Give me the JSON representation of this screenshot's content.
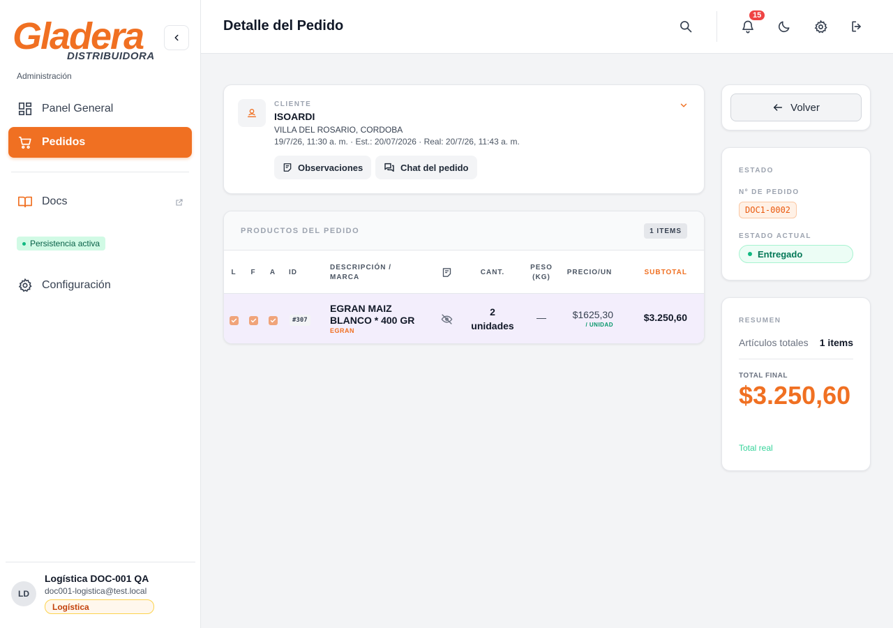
{
  "brand": {
    "logo_main": "Gladera",
    "logo_sub": "DISTRIBUIDORA",
    "accent": "#f07022"
  },
  "sidebar": {
    "section_label": "Administración",
    "items": [
      {
        "label": "Panel General",
        "icon": "dashboard-icon"
      },
      {
        "label": "Pedidos",
        "icon": "cart-icon",
        "active": true
      },
      {
        "label": "Docs",
        "icon": "book-icon",
        "external": true
      },
      {
        "label": "Configuración",
        "icon": "gear-icon"
      }
    ],
    "persistence_badge": "Persistencia activa"
  },
  "user": {
    "initials": "LD",
    "name": "Logística DOC-001 QA",
    "email": "doc001-logistica@test.local",
    "role": "Logística"
  },
  "header": {
    "title": "Detalle del Pedido",
    "notifications_count": "15"
  },
  "client": {
    "label": "CLIENTE",
    "name": "ISOARDI",
    "location": "VILLA DEL ROSARIO, CORDOBA",
    "dates": "19/7/26, 11:30 a. m. · Est.: 20/07/2026 · Real: 20/7/26, 11:43 a. m.",
    "observations_label": "Observaciones",
    "chat_label": "Chat del pedido"
  },
  "products": {
    "title": "PRODUCTOS DEL PEDIDO",
    "items_badge": "1 ITEMS",
    "columns": {
      "l": "L",
      "f": "F",
      "a": "A",
      "id": "ID",
      "desc_line1": "DESCRIPCIÓN /",
      "desc_line2": "MARCA",
      "qty": "CANT.",
      "weight_line1": "PESO",
      "weight_line2": "(KG)",
      "price": "PRECIO/UN",
      "subtotal": "SUBTOTAL"
    },
    "rows": [
      {
        "id": "#307",
        "description_line1": "EGRAN MAIZ",
        "description_line2": "BLANCO * 400 GR",
        "brand": "EGRAN",
        "qty_line1": "2",
        "qty_line2": "unidades",
        "weight": "—",
        "price": "$1625,30",
        "price_unit": "/ UNIDAD",
        "subtotal": "$3.250,60"
      }
    ]
  },
  "actions": {
    "back_label": "Volver"
  },
  "state": {
    "title": "ESTADO",
    "order_no_label": "Nº DE PEDIDO",
    "order_no": "DOC1-0002",
    "current_label": "ESTADO ACTUAL",
    "current": "Entregado"
  },
  "summary": {
    "title": "RESUMEN",
    "articles_label": "Artículos totales",
    "articles_value": "1 items",
    "total_label": "TOTAL FINAL",
    "total_value": "$3.250,60",
    "total_note": "Total real"
  }
}
